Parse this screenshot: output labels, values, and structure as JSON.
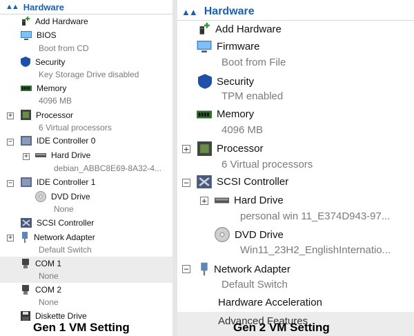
{
  "gen1": {
    "header": "Hardware",
    "items": {
      "add_hardware": "Add Hardware",
      "bios": "BIOS",
      "bios_sub": "Boot from CD",
      "security": "Security",
      "security_sub": "Key Storage Drive disabled",
      "memory": "Memory",
      "memory_sub": "4096 MB",
      "processor": "Processor",
      "processor_sub": "6 Virtual processors",
      "ide0": "IDE Controller 0",
      "hard_drive": "Hard Drive",
      "hard_drive_sub": "debian_ABBC8E69-8A32-4...",
      "ide1": "IDE Controller 1",
      "dvd_drive": "DVD Drive",
      "dvd_sub": "None",
      "scsi": "SCSI Controller",
      "network": "Network Adapter",
      "network_sub": "Default Switch",
      "com1": "COM 1",
      "com1_sub": "None",
      "com2": "COM 2",
      "com2_sub": "None",
      "diskette": "Diskette Drive"
    },
    "caption": "Gen 1 VM Setting"
  },
  "gen2": {
    "header": "Hardware",
    "items": {
      "add_hardware": "Add Hardware",
      "firmware": "Firmware",
      "firmware_sub": "Boot from File",
      "security": "Security",
      "security_sub": "TPM enabled",
      "memory": "Memory",
      "memory_sub": "4096 MB",
      "processor": "Processor",
      "processor_sub": "6 Virtual processors",
      "scsi": "SCSI Controller",
      "hard_drive": "Hard Drive",
      "hard_drive_sub": "personal win 11_E374D943-97...",
      "dvd_drive": "DVD Drive",
      "dvd_sub": "Win11_23H2_EnglishInternatio...",
      "network": "Network Adapter",
      "network_sub": "Default Switch",
      "hw_accel": "Hardware Acceleration",
      "adv_features": "Advanced Features"
    },
    "caption": "Gen 2 VM Setting"
  },
  "expander": {
    "plus": "+",
    "minus": "−"
  },
  "colors": {
    "accent": "#1a5fb0",
    "secondary_text": "#7a7a7a",
    "selection": "#ececec"
  }
}
